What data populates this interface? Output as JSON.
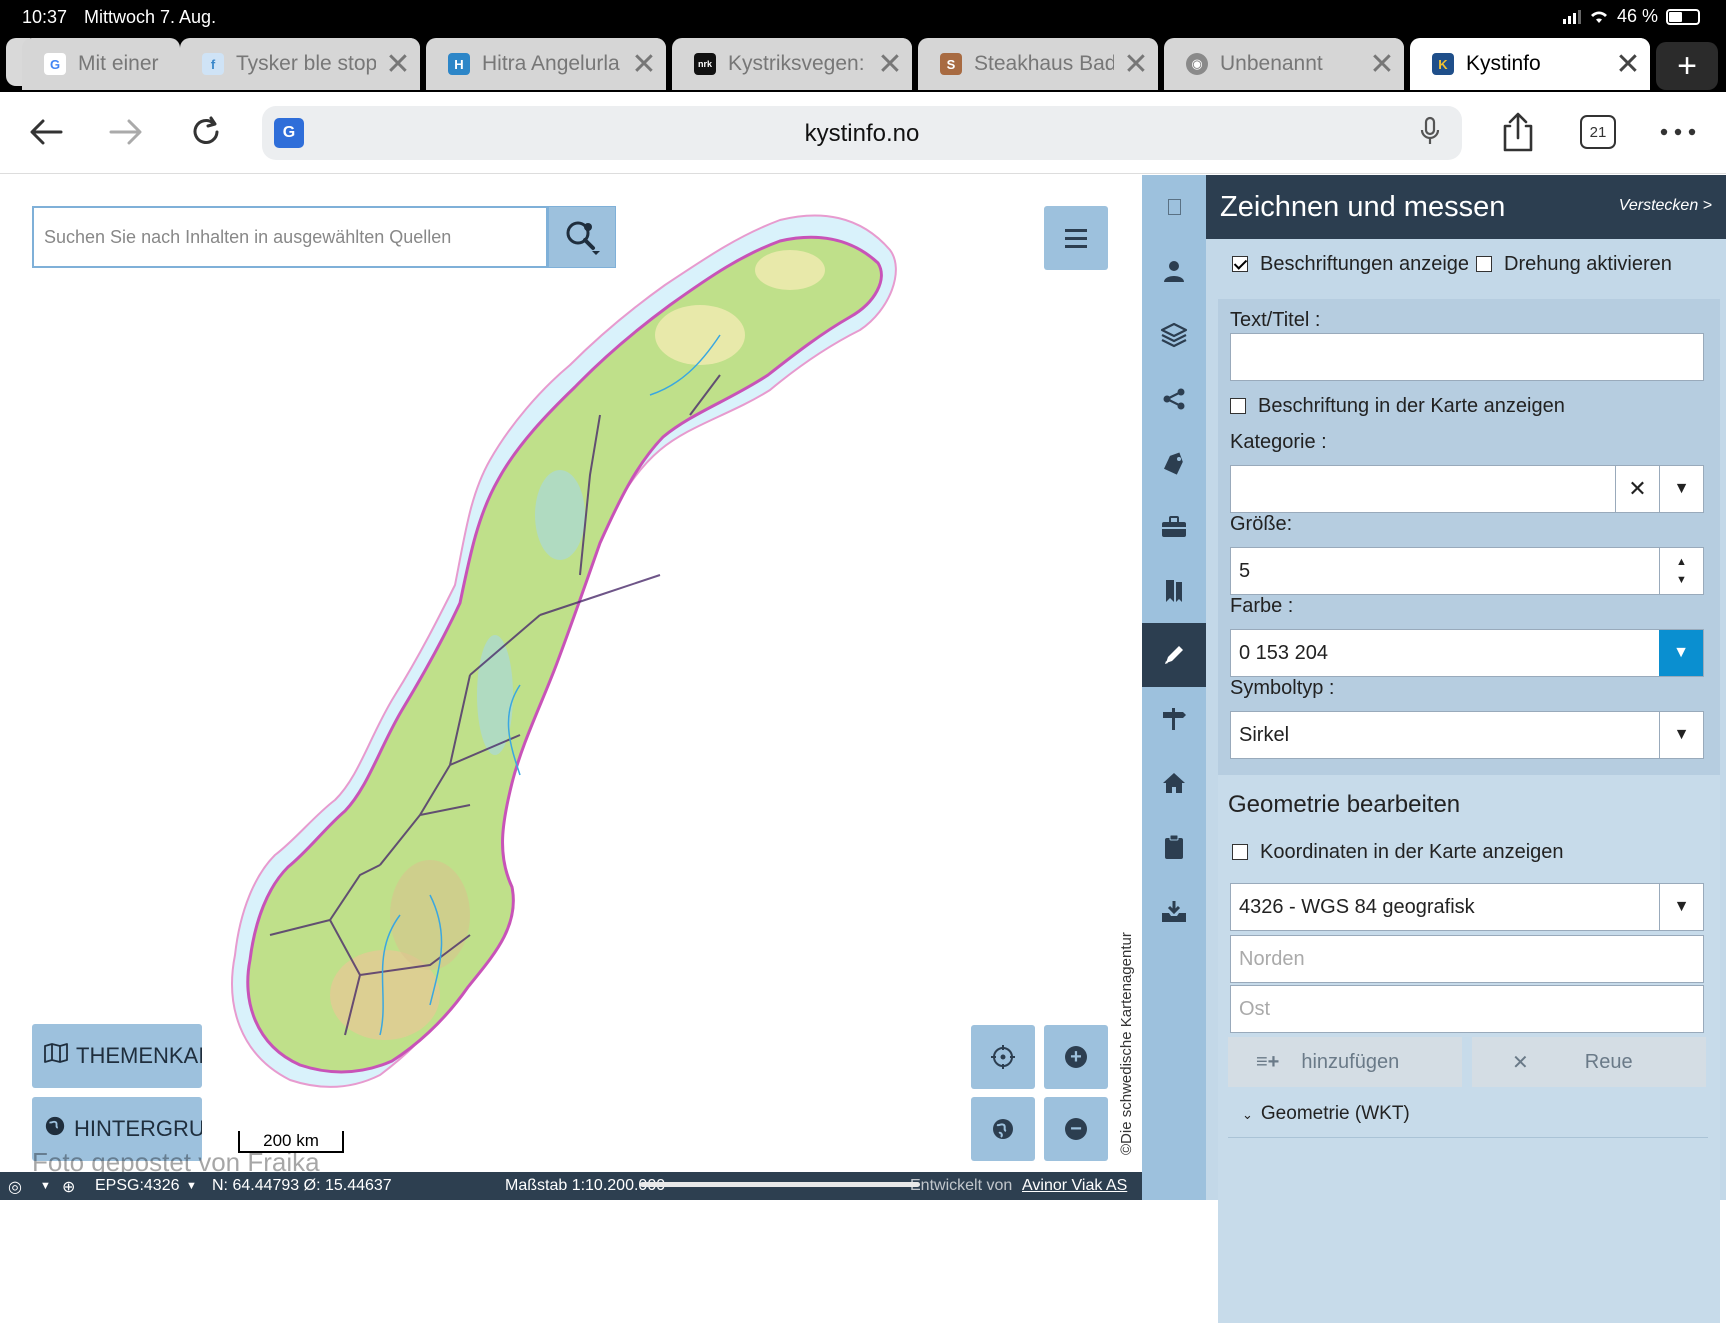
{
  "status": {
    "time": "10:37",
    "date": "Mittwoch 7. Aug.",
    "battery": "46 %"
  },
  "tabs": [
    {
      "title": "Mit einer",
      "favicon": "G",
      "color": "#ffffff",
      "fg": "#4285f4"
    },
    {
      "title": "Tysker ble stop",
      "favicon": "f",
      "color": "#cfe3f6",
      "fg": "#3a87c9"
    },
    {
      "title": "Hitra Angelurla",
      "favicon": "H",
      "color": "#2d86c8",
      "fg": "#ffffff"
    },
    {
      "title": "Kystriksvegen:",
      "favicon": "nrk",
      "color": "#111111",
      "fg": "#ffffff"
    },
    {
      "title": "Steakhaus Bad",
      "favicon": "S",
      "color": "#a86b42",
      "fg": "#ffffff"
    },
    {
      "title": "Unbenannt",
      "favicon": "◉",
      "color": "#8a8a8a",
      "fg": "#ffffff"
    },
    {
      "title": "Kystinfo",
      "favicon": "K",
      "color": "#1f4f8a",
      "fg": "#f2c230"
    }
  ],
  "browser": {
    "url": "kystinfo.no",
    "tab_count": "21"
  },
  "map": {
    "search_placeholder": "Suchen Sie nach Inhalten in ausgewählten Quellen",
    "theme_button": "THEMENKAI",
    "background_button": "HINTERGRU",
    "scale_label": "200 km",
    "watermark": "Foto gepostet von Fraika",
    "attribution": "©Die schwedische Kartenagentur",
    "statusbar": {
      "epsg": "EPSG:4326",
      "coords": "N: 64.44793 Ø: 15.44637",
      "scale": "Maßstab 1:10.200.000",
      "credit_prefix": "Entwickelt von",
      "credit": "Avinor Viak AS"
    }
  },
  "panel": {
    "title": "Zeichnen und messen",
    "hide": "Verstecken >",
    "show_labels": "Beschriftungen anzeige",
    "enable_rotation": "Drehung aktivieren",
    "text_title_label": "Text/Titel :",
    "show_label_in_map": "Beschriftung in der Karte anzeigen",
    "category_label": "Kategorie :",
    "size_label": "Größe:",
    "size_value": "5",
    "color_label": "Farbe :",
    "color_value": "0 153 204",
    "symbol_label": "Symboltyp :",
    "symbol_value": "Sirkel",
    "geometry_title": "Geometrie bearbeiten",
    "show_coords": "Koordinaten in der Karte anzeigen",
    "crs_value": "4326 - WGS 84 geografisk",
    "north_placeholder": "Norden",
    "east_placeholder": "Ost",
    "add_button": "hinzufügen",
    "clear_button": "Reue",
    "wkt_toggle": "Geometrie (WKT)"
  },
  "colors": {
    "accent": "#2c3e50",
    "rail": "#9dc1dd",
    "panel": "#c3d8e8",
    "active_dropdown": "#0a8fd0"
  }
}
